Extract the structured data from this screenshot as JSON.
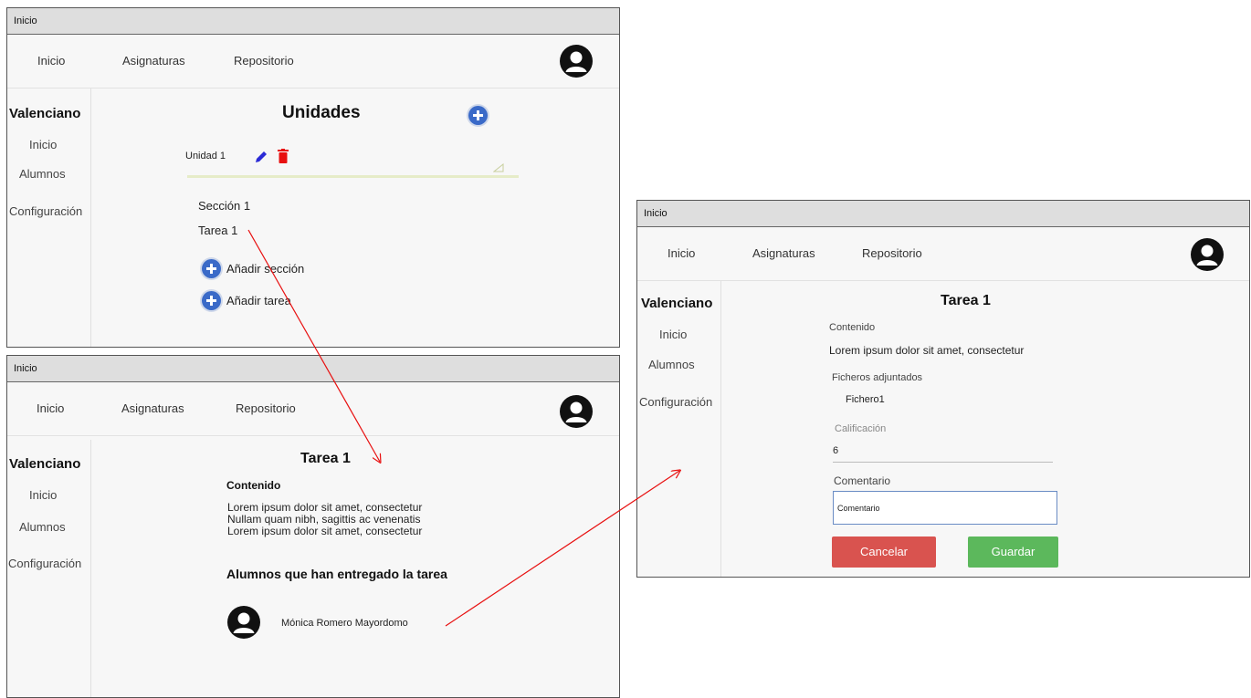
{
  "windows": {
    "w1": {
      "title": "Inicio",
      "nav": [
        "Inicio",
        "Asignaturas",
        "Repositorio"
      ],
      "sidebar": {
        "brand": "Valenciano",
        "items": [
          "Inicio",
          "Alumnos",
          "Configuración"
        ]
      },
      "heading": "Unidades",
      "unit_label": "Unidad 1",
      "section": "Sección 1",
      "task": "Tarea 1",
      "add_section": "Añadir sección",
      "add_task": "Añadir tarea"
    },
    "w2": {
      "title": "Inicio",
      "nav": [
        "Inicio",
        "Asignaturas",
        "Repositorio"
      ],
      "sidebar": {
        "brand": "Valenciano",
        "items": [
          "Inicio",
          "Alumnos",
          "Configuración"
        ]
      },
      "heading": "Tarea 1",
      "content_label": "Contenido",
      "content_lines": [
        "Lorem ipsum dolor sit amet, consectetur",
        "Nullam quam nibh, sagittis ac venenatis",
        "Lorem ipsum dolor sit amet, consectetur"
      ],
      "delivered_heading": "Alumnos que han entregado la tarea",
      "student_name": "Mónica Romero Mayordomo"
    },
    "w3": {
      "title": "Inicio",
      "nav": [
        "Inicio",
        "Asignaturas",
        "Repositorio"
      ],
      "sidebar": {
        "brand": "Valenciano",
        "items": [
          "Inicio",
          "Alumnos",
          "Configuración"
        ]
      },
      "heading": "Tarea 1",
      "content_label": "Contenido",
      "content_text": "Lorem ipsum dolor sit amet, consectetur",
      "files_label": "Ficheros adjuntados",
      "file_name": "Fichero1",
      "grade_label": "Calificación",
      "grade_value": "6",
      "comment_label": "Comentario",
      "comment_value": "Comentario",
      "cancel_label": "Cancelar",
      "save_label": "Guardar"
    }
  },
  "colors": {
    "delete": "#e81010",
    "edit": "#2b2bd6",
    "add": "#3a6ac8",
    "cancel": "#d9534f",
    "save": "#5cb85c",
    "arrow": "#e81010"
  },
  "icons": {
    "avatar": "user-avatar-icon",
    "edit": "pencil-icon",
    "delete": "trash-icon",
    "add": "plus-circle-icon"
  }
}
